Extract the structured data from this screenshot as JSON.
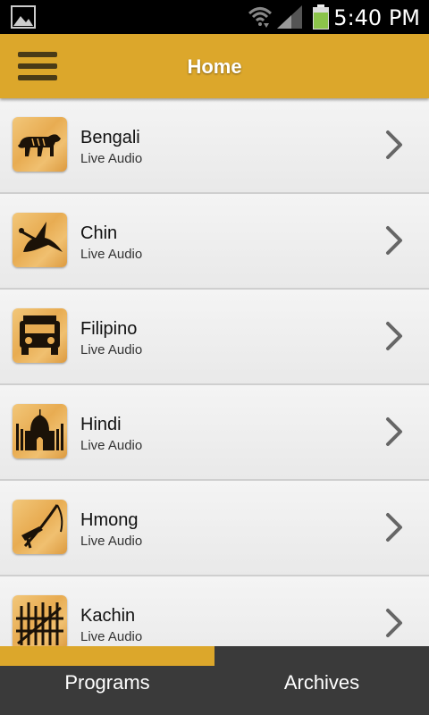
{
  "status_bar": {
    "time": "5:40 PM"
  },
  "header": {
    "title": "Home"
  },
  "list": [
    {
      "title": "Bengali",
      "subtitle": "Live Audio",
      "icon": "tiger-icon"
    },
    {
      "title": "Chin",
      "subtitle": "Live Audio",
      "icon": "bird-icon"
    },
    {
      "title": "Filipino",
      "subtitle": "Live Audio",
      "icon": "jeepney-icon"
    },
    {
      "title": "Hindi",
      "subtitle": "Live Audio",
      "icon": "taj-mahal-icon"
    },
    {
      "title": "Hmong",
      "subtitle": "Live Audio",
      "icon": "crossbow-icon"
    },
    {
      "title": "Kachin",
      "subtitle": "Live Audio",
      "icon": "bamboo-fence-icon"
    }
  ],
  "tabs": [
    {
      "label": "Programs",
      "active": true
    },
    {
      "label": "Archives",
      "active": false
    }
  ],
  "colors": {
    "accent": "#dca72b",
    "tabbar": "#3a3a3a"
  }
}
